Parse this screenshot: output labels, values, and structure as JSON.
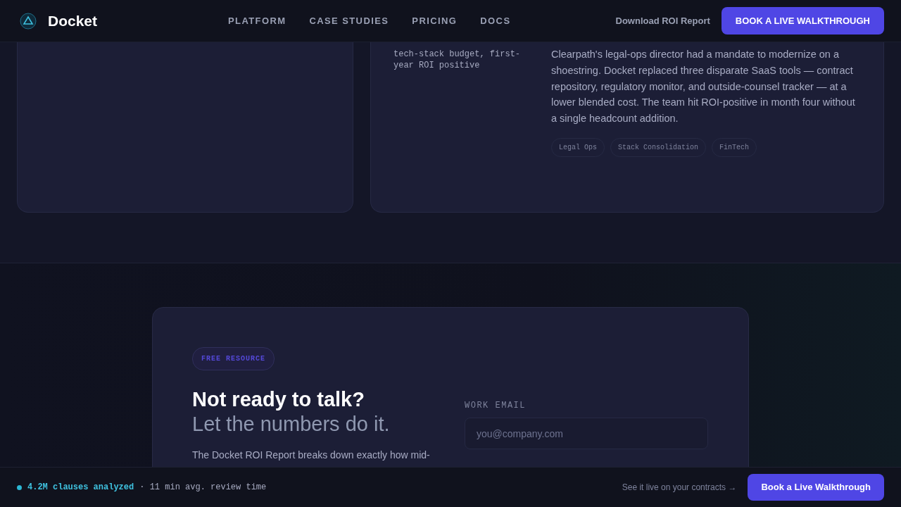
{
  "navbar": {
    "brand": "Docket",
    "links": [
      {
        "label": "PLATFORM"
      },
      {
        "label": "CASE STUDIES"
      },
      {
        "label": "PRICING"
      },
      {
        "label": "DOCS"
      }
    ],
    "secondary_link": "Download ROI Report",
    "cta": "BOOK A LIVE WALKTHROUGH"
  },
  "case_study": {
    "result": "tech-stack budget, first-year ROI positive",
    "description": "Clearpath's legal-ops director had a mandate to modernize on a shoestring. Docket replaced three disparate SaaS tools — contract repository, regulatory monitor, and outside-counsel tracker — at a lower blended cost. The team hit ROI-positive in month four without a single headcount addition.",
    "tags": [
      "Legal Ops",
      "Stack Consolidation",
      "FinTech"
    ]
  },
  "resource": {
    "badge": "FREE RESOURCE",
    "heading": "Not ready to talk?",
    "subheading": "Let the numbers do it.",
    "body": "The Docket ROI Report breaks down exactly how mid-",
    "email_label": "WORK EMAIL",
    "email_placeholder": "you@company.com"
  },
  "bottom_bar": {
    "stat": "4.2M clauses analyzed",
    "detail": "· 11 min avg. review time",
    "link": "See it live on your contracts →",
    "cta": "Book a Live Walkthrough"
  }
}
